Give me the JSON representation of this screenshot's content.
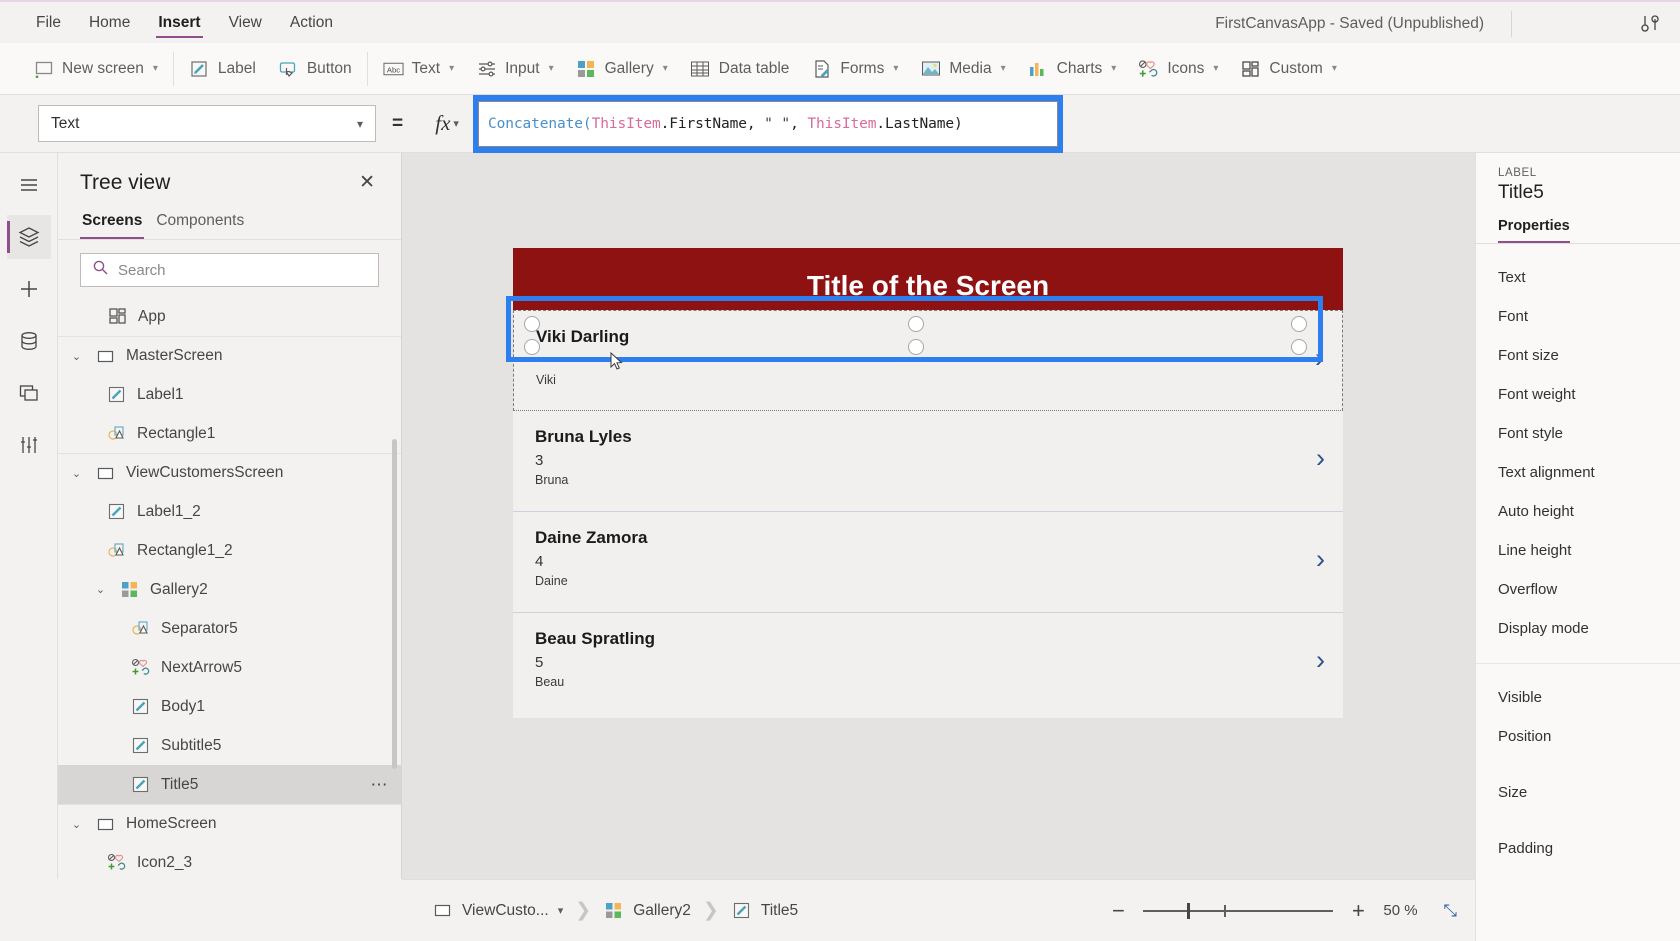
{
  "app": {
    "title": "FirstCanvasApp - Saved (Unpublished)"
  },
  "menubar": {
    "tabs": [
      {
        "label": "File",
        "active": false
      },
      {
        "label": "Home",
        "active": false
      },
      {
        "label": "Insert",
        "active": true
      },
      {
        "label": "View",
        "active": false
      },
      {
        "label": "Action",
        "active": false
      }
    ],
    "icons": [
      {
        "name": "help-feedback-icon",
        "glyph": "⚙"
      }
    ]
  },
  "ribbon": {
    "groups": [
      {
        "items": [
          {
            "label": "New screen",
            "icon": "new-screen-icon",
            "caret": true
          }
        ]
      },
      {
        "items": [
          {
            "label": "Label",
            "icon": "label-icon",
            "caret": false
          },
          {
            "label": "Button",
            "icon": "button-icon",
            "caret": false
          }
        ]
      },
      {
        "items": [
          {
            "label": "Text",
            "icon": "text-icon",
            "caret": true
          },
          {
            "label": "Input",
            "icon": "input-icon",
            "caret": true
          },
          {
            "label": "Gallery",
            "icon": "gallery-icon",
            "caret": true
          },
          {
            "label": "Data table",
            "icon": "data-table-icon",
            "caret": false
          },
          {
            "label": "Forms",
            "icon": "forms-icon",
            "caret": true
          },
          {
            "label": "Media",
            "icon": "media-icon",
            "caret": true
          },
          {
            "label": "Charts",
            "icon": "charts-icon",
            "caret": true
          },
          {
            "label": "Icons",
            "icon": "icons-icon",
            "caret": true
          },
          {
            "label": "Custom",
            "icon": "custom-icon",
            "caret": true
          }
        ]
      }
    ]
  },
  "formula_bar": {
    "property_selected": "Text",
    "equals": "=",
    "fx_label": "fx",
    "formula_tokens": [
      {
        "t": "Concatenate(",
        "k": "fn"
      },
      {
        "t": "ThisItem",
        "k": "obj"
      },
      {
        "t": ".FirstName, ",
        "k": "plain"
      },
      {
        "t": "\" \"",
        "k": "str"
      },
      {
        "t": ", ",
        "k": "plain"
      },
      {
        "t": "ThisItem",
        "k": "obj"
      },
      {
        "t": ".LastName)",
        "k": "plain"
      }
    ],
    "formula_plain": "Concatenate(ThisItem.FirstName, \" \", ThisItem.LastName)"
  },
  "rail": {
    "items": [
      {
        "name": "hamburger-menu-icon",
        "active": false
      },
      {
        "name": "tree-view-icon",
        "active": true
      },
      {
        "name": "insert-plus-icon",
        "active": false
      },
      {
        "name": "data-sources-icon",
        "active": false
      },
      {
        "name": "media-library-icon",
        "active": false
      },
      {
        "name": "advanced-tools-icon",
        "active": false
      }
    ]
  },
  "tree_view": {
    "title": "Tree view",
    "close_label": "✕",
    "tabs": [
      {
        "label": "Screens",
        "active": true
      },
      {
        "label": "Components",
        "active": false
      }
    ],
    "search": {
      "value": "",
      "placeholder": "Search"
    },
    "nodes": [
      {
        "label": "App",
        "icon": "app-icon",
        "indent": 0,
        "chevron": "",
        "selected": false,
        "divider": false
      },
      {
        "label": "MasterScreen",
        "icon": "screen-icon",
        "indent": 0,
        "chevron": "⌄",
        "selected": false,
        "divider": true
      },
      {
        "label": "Label1",
        "icon": "label-icon",
        "indent": 1,
        "chevron": "",
        "selected": false,
        "divider": false
      },
      {
        "label": "Rectangle1",
        "icon": "shape-icon",
        "indent": 1,
        "chevron": "",
        "selected": false,
        "divider": false
      },
      {
        "label": "ViewCustomersScreen",
        "icon": "screen-icon",
        "indent": 0,
        "chevron": "⌄",
        "selected": false,
        "divider": true
      },
      {
        "label": "Label1_2",
        "icon": "label-icon",
        "indent": 1,
        "chevron": "",
        "selected": false,
        "divider": false
      },
      {
        "label": "Rectangle1_2",
        "icon": "shape-icon",
        "indent": 1,
        "chevron": "",
        "selected": false,
        "divider": false
      },
      {
        "label": "Gallery2",
        "icon": "gallery-icon",
        "indent": 1,
        "chevron": "⌄",
        "selected": false,
        "divider": false
      },
      {
        "label": "Separator5",
        "icon": "shape-icon",
        "indent": 2,
        "chevron": "",
        "selected": false,
        "divider": false
      },
      {
        "label": "NextArrow5",
        "icon": "icons-icon",
        "indent": 2,
        "chevron": "",
        "selected": false,
        "divider": false
      },
      {
        "label": "Body1",
        "icon": "label-icon",
        "indent": 2,
        "chevron": "",
        "selected": false,
        "divider": false
      },
      {
        "label": "Subtitle5",
        "icon": "label-icon",
        "indent": 2,
        "chevron": "",
        "selected": false,
        "divider": false
      },
      {
        "label": "Title5",
        "icon": "label-icon",
        "indent": 2,
        "chevron": "",
        "selected": true,
        "divider": false,
        "more": "⋯"
      },
      {
        "label": "HomeScreen",
        "icon": "screen-icon",
        "indent": 0,
        "chevron": "⌄",
        "selected": false,
        "divider": true
      },
      {
        "label": "Icon2_3",
        "icon": "icons-icon",
        "indent": 1,
        "chevron": "",
        "selected": false,
        "divider": false
      }
    ]
  },
  "canvas": {
    "screen_title": "Title of the Screen",
    "header_color": "#8f1212",
    "gallery_items": [
      {
        "title": "Viki  Darling",
        "subtitle": "",
        "body": "Viki",
        "selected": true
      },
      {
        "title": "Bruna  Lyles",
        "subtitle": "3",
        "body": "Bruna",
        "selected": false
      },
      {
        "title": "Daine  Zamora",
        "subtitle": "4",
        "body": "Daine",
        "selected": false
      },
      {
        "title": "Beau  Spratling",
        "subtitle": "5",
        "body": "Beau",
        "selected": false
      }
    ],
    "arrow_glyph": "›",
    "selection_color": "#2d7ff0"
  },
  "properties_panel": {
    "kind": "LABEL",
    "name": "Title5",
    "tab": "Properties",
    "group1": [
      "Text",
      "Font",
      "Font size",
      "Font weight",
      "Font style",
      "Text alignment",
      "Auto height",
      "Line height",
      "Overflow",
      "Display mode"
    ],
    "group2": [
      "Visible",
      "Position",
      "Size",
      "Padding"
    ]
  },
  "statusbar": {
    "breadcrumb": [
      {
        "label": "ViewCusto...",
        "icon": "screen-icon",
        "caret": true
      },
      {
        "label": "Gallery2",
        "icon": "gallery-icon",
        "caret": false
      },
      {
        "label": "Title5",
        "icon": "label-icon",
        "caret": false
      }
    ],
    "zoom_out": "−",
    "zoom_in": "+",
    "zoom_value": "50",
    "zoom_unit": "%",
    "fit_label": "⤡"
  }
}
